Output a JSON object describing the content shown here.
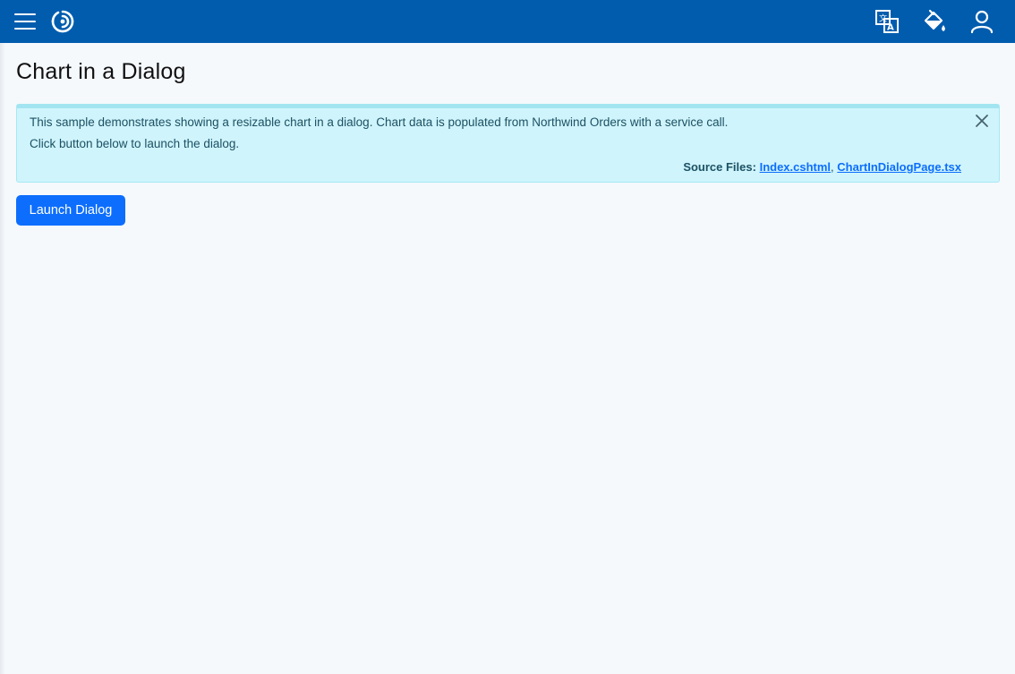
{
  "header": {
    "menu_icon": "hamburger-menu-icon",
    "logo_icon": "swirl-logo-icon",
    "actions": [
      {
        "icon": "translate-icon"
      },
      {
        "icon": "paint-bucket-icon"
      },
      {
        "icon": "user-icon"
      }
    ]
  },
  "page": {
    "title": "Chart in a Dialog"
  },
  "alert": {
    "line1": "This sample demonstrates showing a resizable chart in a dialog. Chart data is populated from Northwind Orders with a service call.",
    "line2": "Click button below to launch the dialog.",
    "source_label": "Source Files:",
    "files": [
      "Index.cshtml",
      "ChartInDialogPage.tsx"
    ],
    "separator": ",",
    "close_icon": "close-icon"
  },
  "actions": {
    "launch_label": "Launch Dialog"
  },
  "colors": {
    "header_bg": "#015cae",
    "page_bg": "#f5f9fc",
    "alert_bg": "#cff4fc",
    "primary": "#0d6efd"
  }
}
